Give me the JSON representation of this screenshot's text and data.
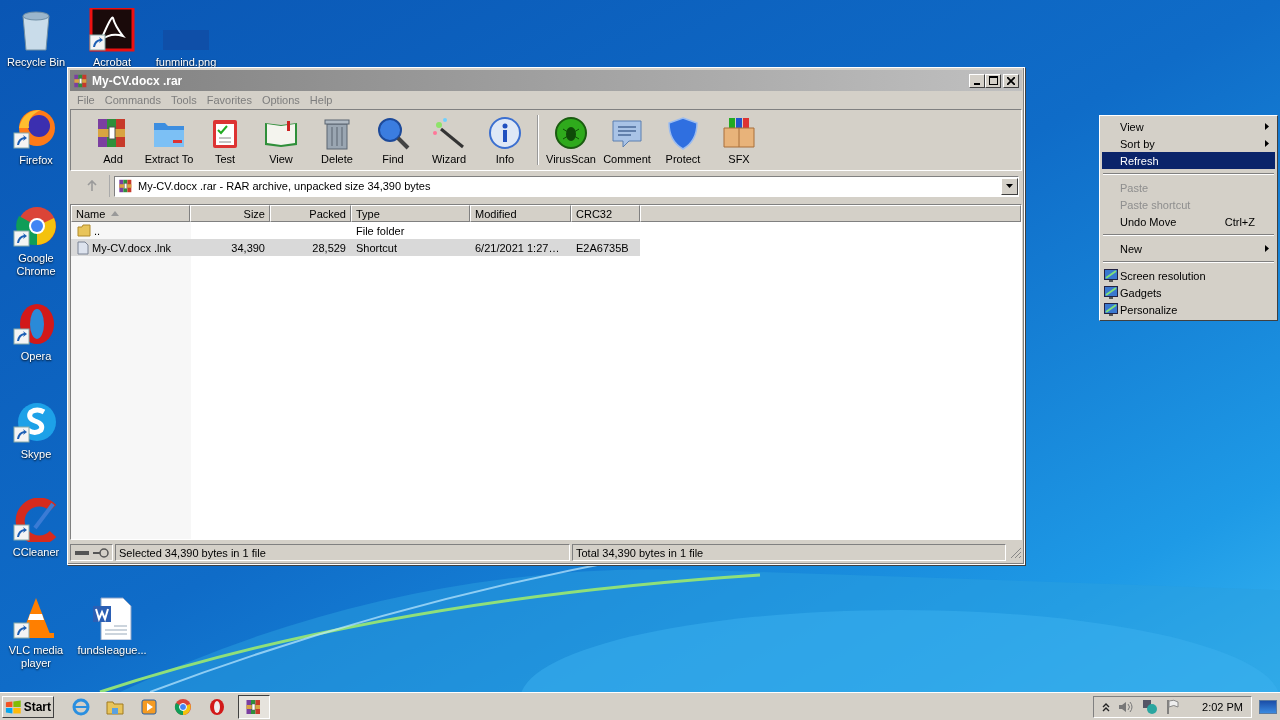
{
  "desktop_icons": [
    {
      "label": "Recycle Bin",
      "shortcut": false
    },
    {
      "label": "Acrobat",
      "shortcut": true
    },
    {
      "label": "funmind.png",
      "shortcut": false
    },
    {
      "label": "Firefox",
      "shortcut": true
    },
    {
      "label": "Google Chrome",
      "shortcut": true
    },
    {
      "label": "Opera",
      "shortcut": true
    },
    {
      "label": "Skype",
      "shortcut": true
    },
    {
      "label": "CCleaner",
      "shortcut": true
    },
    {
      "label": "VLC media player",
      "shortcut": true
    },
    {
      "label": "fundsleague...",
      "shortcut": false
    }
  ],
  "window": {
    "title": "My-CV.docx .rar",
    "menu": [
      "File",
      "Commands",
      "Tools",
      "Favorites",
      "Options",
      "Help"
    ],
    "toolbar_groups": [
      [
        "Add",
        "Extract To",
        "Test",
        "View",
        "Delete",
        "Find",
        "Wizard",
        "Info"
      ],
      [
        "VirusScan",
        "Comment",
        "Protect",
        "SFX"
      ]
    ],
    "up_disabled": true,
    "address": "My-CV.docx .rar - RAR archive, unpacked size 34,390 bytes",
    "columns": [
      {
        "label": "Name",
        "sorted": true
      },
      {
        "label": "Size",
        "sorted": false
      },
      {
        "label": "Packed",
        "sorted": false
      },
      {
        "label": "Type",
        "sorted": false
      },
      {
        "label": "Modified",
        "sorted": false
      },
      {
        "label": "CRC32",
        "sorted": false
      }
    ],
    "rows": [
      {
        "kind": "folder",
        "selected": false,
        "cells": [
          "..",
          "",
          "",
          "File folder",
          "",
          ""
        ]
      },
      {
        "kind": "file",
        "selected": true,
        "cells": [
          "My-CV.docx .lnk",
          "34,390",
          "28,529",
          "Shortcut",
          "6/21/2021 1:27…",
          "E2A6735B"
        ]
      }
    ],
    "status_left": "Selected 34,390 bytes in 1 file",
    "status_right": "Total 34,390 bytes in 1 file"
  },
  "context_menu": [
    {
      "kind": "item",
      "label": "View",
      "submenu": true,
      "disabled": false,
      "selected": false
    },
    {
      "kind": "item",
      "label": "Sort by",
      "submenu": true,
      "disabled": false,
      "selected": false
    },
    {
      "kind": "item",
      "label": "Refresh",
      "submenu": false,
      "disabled": false,
      "selected": true
    },
    {
      "kind": "separator"
    },
    {
      "kind": "item",
      "label": "Paste",
      "submenu": false,
      "disabled": true,
      "selected": false
    },
    {
      "kind": "item",
      "label": "Paste shortcut",
      "submenu": false,
      "disabled": true,
      "selected": false
    },
    {
      "kind": "item",
      "label": "Undo Move",
      "shortcut": "Ctrl+Z",
      "submenu": false,
      "disabled": false,
      "selected": false
    },
    {
      "kind": "separator"
    },
    {
      "kind": "item",
      "label": "New",
      "submenu": true,
      "disabled": false,
      "selected": false
    },
    {
      "kind": "separator"
    },
    {
      "kind": "icon-item",
      "label": "Screen resolution",
      "submenu": false,
      "disabled": false,
      "selected": false
    },
    {
      "kind": "icon-item",
      "label": "Gadgets",
      "submenu": false,
      "disabled": false,
      "selected": false
    },
    {
      "kind": "icon-item",
      "label": "Personalize",
      "submenu": false,
      "disabled": false,
      "selected": false
    }
  ],
  "taskbar": {
    "start": "Start",
    "apps": [
      {
        "active": false
      },
      {
        "active": false
      },
      {
        "active": false
      },
      {
        "active": false
      },
      {
        "active": false
      },
      {
        "active": true
      }
    ],
    "clock": "2:02 PM"
  }
}
